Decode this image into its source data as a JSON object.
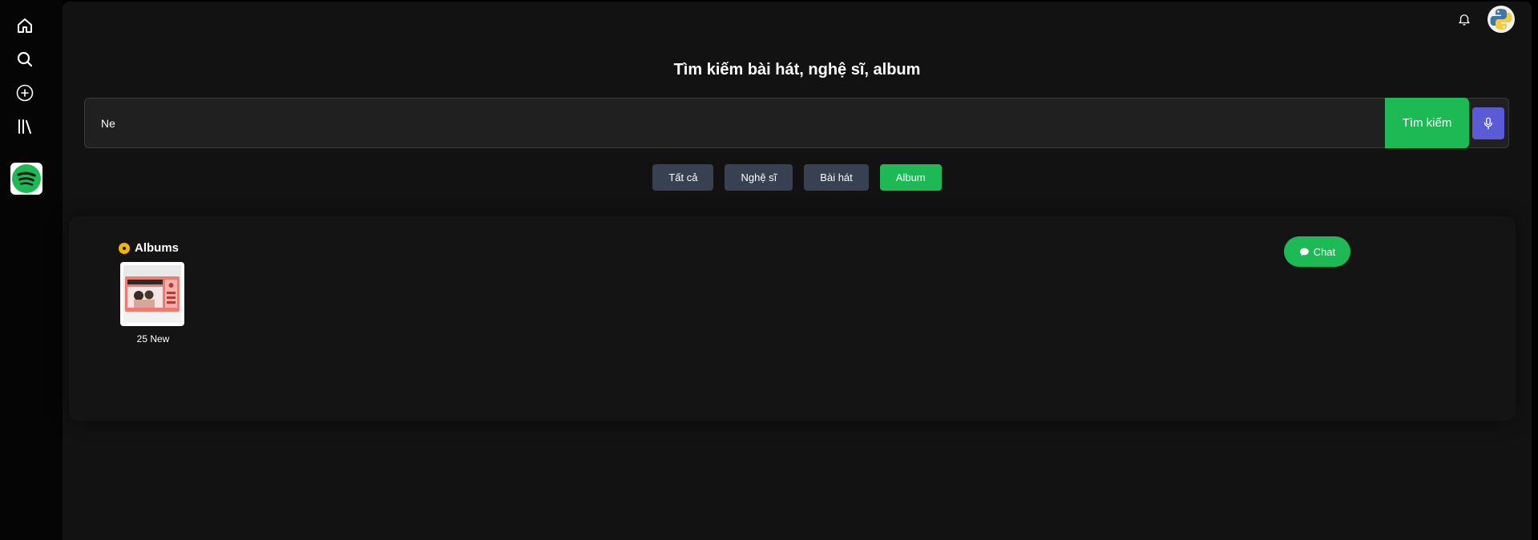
{
  "sidebar": {
    "items": [
      {
        "icon": "home-icon"
      },
      {
        "icon": "search-icon"
      },
      {
        "icon": "add-circle-icon"
      },
      {
        "icon": "library-icon"
      }
    ],
    "logo_icon": "spotify-logo-icon"
  },
  "header": {
    "notification_icon": "bell-icon",
    "avatar_icon": "python-logo-avatar"
  },
  "page": {
    "title": "Tìm kiếm bài hát, nghệ sĩ, album"
  },
  "search": {
    "value": "Ne",
    "button_label": "Tìm kiếm",
    "mic_icon": "microphone-icon"
  },
  "filters": {
    "items": [
      {
        "label": "Tất cả",
        "active": false
      },
      {
        "label": "Nghệ sĩ",
        "active": false
      },
      {
        "label": "Bài hát",
        "active": false
      },
      {
        "label": "Album",
        "active": true
      }
    ]
  },
  "results": {
    "section_title": "Albums",
    "albums": [
      {
        "name": "25 New"
      }
    ]
  },
  "chat": {
    "label": "Chat"
  },
  "colors": {
    "accent": "#1db954",
    "mic": "#5b5bd6",
    "filter_inactive": "#374151",
    "album_icon": "#f5b400"
  }
}
